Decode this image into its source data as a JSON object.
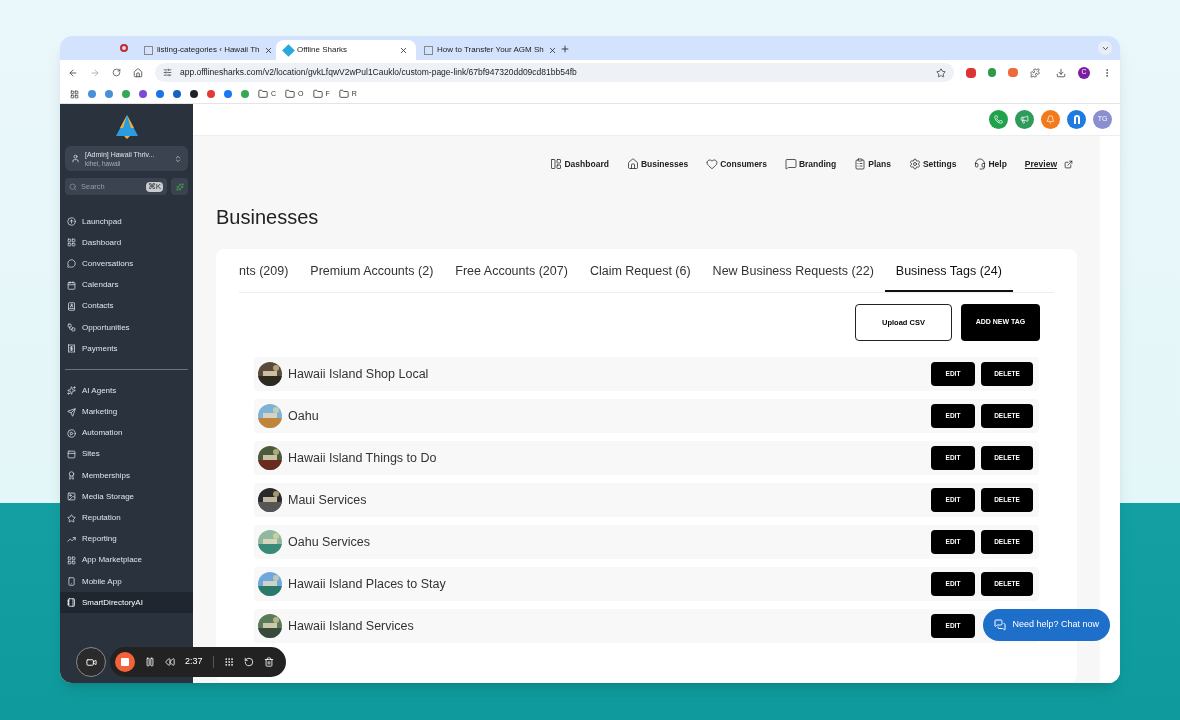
{
  "browser": {
    "tabs": [
      {
        "title": "listing-categories ‹ Hawaii Th",
        "selected": false
      },
      {
        "title": "Offline Sharks",
        "selected": true
      },
      {
        "title": "How to Transfer Your AGM Sh",
        "selected": false
      }
    ],
    "url": "app.offlinesharks.com/v2/location/gvkLfqwV2wPul1Cauklo/custom-page-link/67bf947320dd09cd81bb54fb",
    "bookmark_folders": [
      "C",
      "O",
      "F",
      "R"
    ],
    "profile": "C"
  },
  "sidebar": {
    "account": {
      "name": "[Admin] Hawaii Thriv...",
      "location": "kihei, hawaii"
    },
    "search": {
      "placeholder": "Search",
      "shortcut": "⌘K"
    },
    "groups": [
      [
        {
          "label": "Launchpad",
          "selected": false
        },
        {
          "label": "Dashboard",
          "selected": false
        },
        {
          "label": "Conversations",
          "selected": false
        },
        {
          "label": "Calendars",
          "selected": false
        },
        {
          "label": "Contacts",
          "selected": false
        },
        {
          "label": "Opportunities",
          "selected": false
        },
        {
          "label": "Payments",
          "selected": false
        }
      ],
      [
        {
          "label": "AI Agents",
          "selected": false
        },
        {
          "label": "Marketing",
          "selected": false
        },
        {
          "label": "Automation",
          "selected": false
        },
        {
          "label": "Sites",
          "selected": false
        },
        {
          "label": "Memberships",
          "selected": false
        },
        {
          "label": "Media Storage",
          "selected": false
        },
        {
          "label": "Reputation",
          "selected": false
        },
        {
          "label": "Reporting",
          "selected": false
        },
        {
          "label": "App Marketplace",
          "selected": false
        },
        {
          "label": "Mobile App",
          "selected": false
        },
        {
          "label": "SmartDirectoryAI",
          "selected": true
        }
      ]
    ]
  },
  "header": {
    "avatar": "TG"
  },
  "nav": [
    "Dashboard",
    "Businesses",
    "Consumers",
    "Branding",
    "Plans",
    "Settings",
    "Help"
  ],
  "preview_link": "Preview",
  "page_title": "Businesses",
  "tabs": [
    {
      "label": "nts (209)",
      "selected": false
    },
    {
      "label": "Premium Accounts (2)",
      "selected": false
    },
    {
      "label": "Free Accounts (207)",
      "selected": false
    },
    {
      "label": "Claim Request (6)",
      "selected": false
    },
    {
      "label": "New Business Requests (22)",
      "selected": false
    },
    {
      "label": "Business Tags (24)",
      "selected": true
    }
  ],
  "actions": {
    "upload": "Upload CSV",
    "add": "ADD NEW TAG"
  },
  "tags": [
    {
      "name": "Hawaii Island Shop Local",
      "buttons": [
        "EDIT",
        "DELETE"
      ]
    },
    {
      "name": "Oahu",
      "buttons": [
        "EDIT",
        "DELETE"
      ]
    },
    {
      "name": "Hawaii Island Things to Do",
      "buttons": [
        "EDIT",
        "DELETE"
      ]
    },
    {
      "name": "Maui Services",
      "buttons": [
        "EDIT",
        "DELETE"
      ]
    },
    {
      "name": "Oahu Services",
      "buttons": [
        "EDIT",
        "DELETE"
      ]
    },
    {
      "name": "Hawaii Island Places to Stay",
      "buttons": [
        "EDIT",
        "DELETE"
      ]
    },
    {
      "name": "Hawaii Island Services",
      "buttons": [
        "EDIT"
      ]
    }
  ],
  "chat": {
    "label": "Need help? Chat now"
  },
  "recorder": {
    "time": "2:37"
  }
}
